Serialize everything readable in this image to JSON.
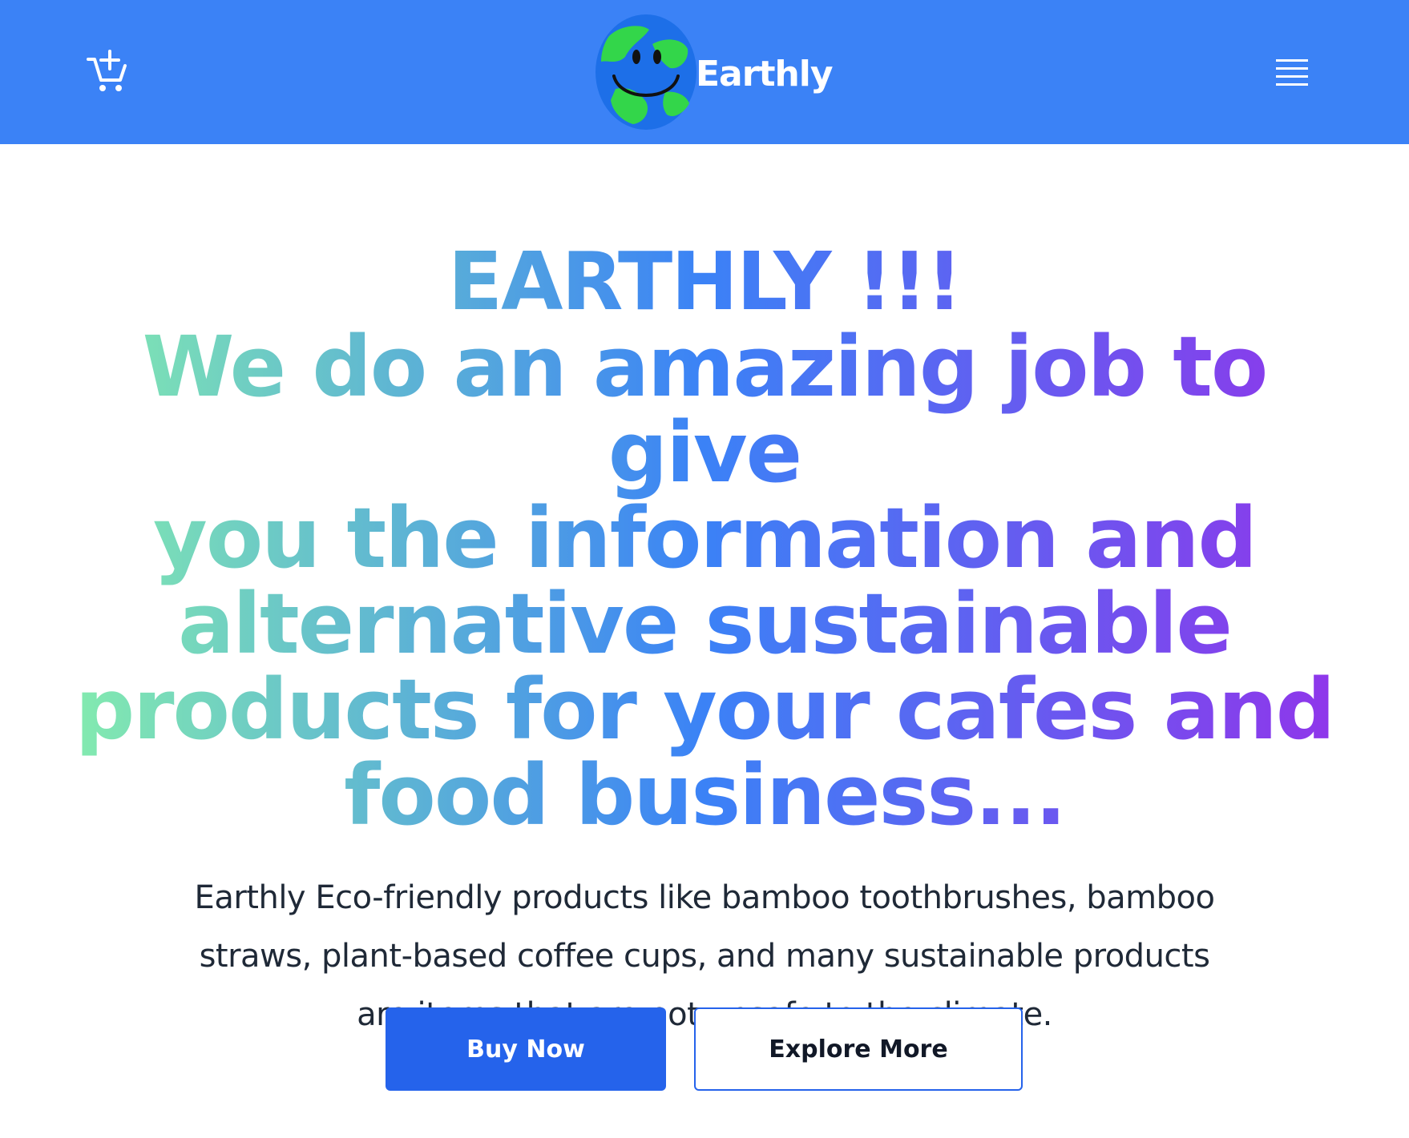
{
  "navbar": {
    "background": "#3b82f6",
    "cart_icon": "cart-plus-icon",
    "brand_logo": "smiling-earth-logo",
    "brand_name": "Earthly",
    "menu_icon": "hamburger-menu-icon"
  },
  "hero": {
    "title_line1": "EARTHLY !!!",
    "title_line2": "We do an amazing job to give",
    "title_line3": "you the information and",
    "title_line4": "alternative sustainable",
    "title_line5": "products for your cafes and",
    "title_line6": "food business...",
    "title_gradient": [
      "#86efac",
      "#3b82f6",
      "#9333ea"
    ],
    "description": "Earthly Eco-friendly products like bamboo toothbrushes, bamboo straws, plant-based coffee cups, and many sustainable products are items that are not unsafe to the climate.",
    "buttons": {
      "primary_label": "Buy Now",
      "secondary_label": "Explore More"
    },
    "accent_color": "#2563eb"
  }
}
